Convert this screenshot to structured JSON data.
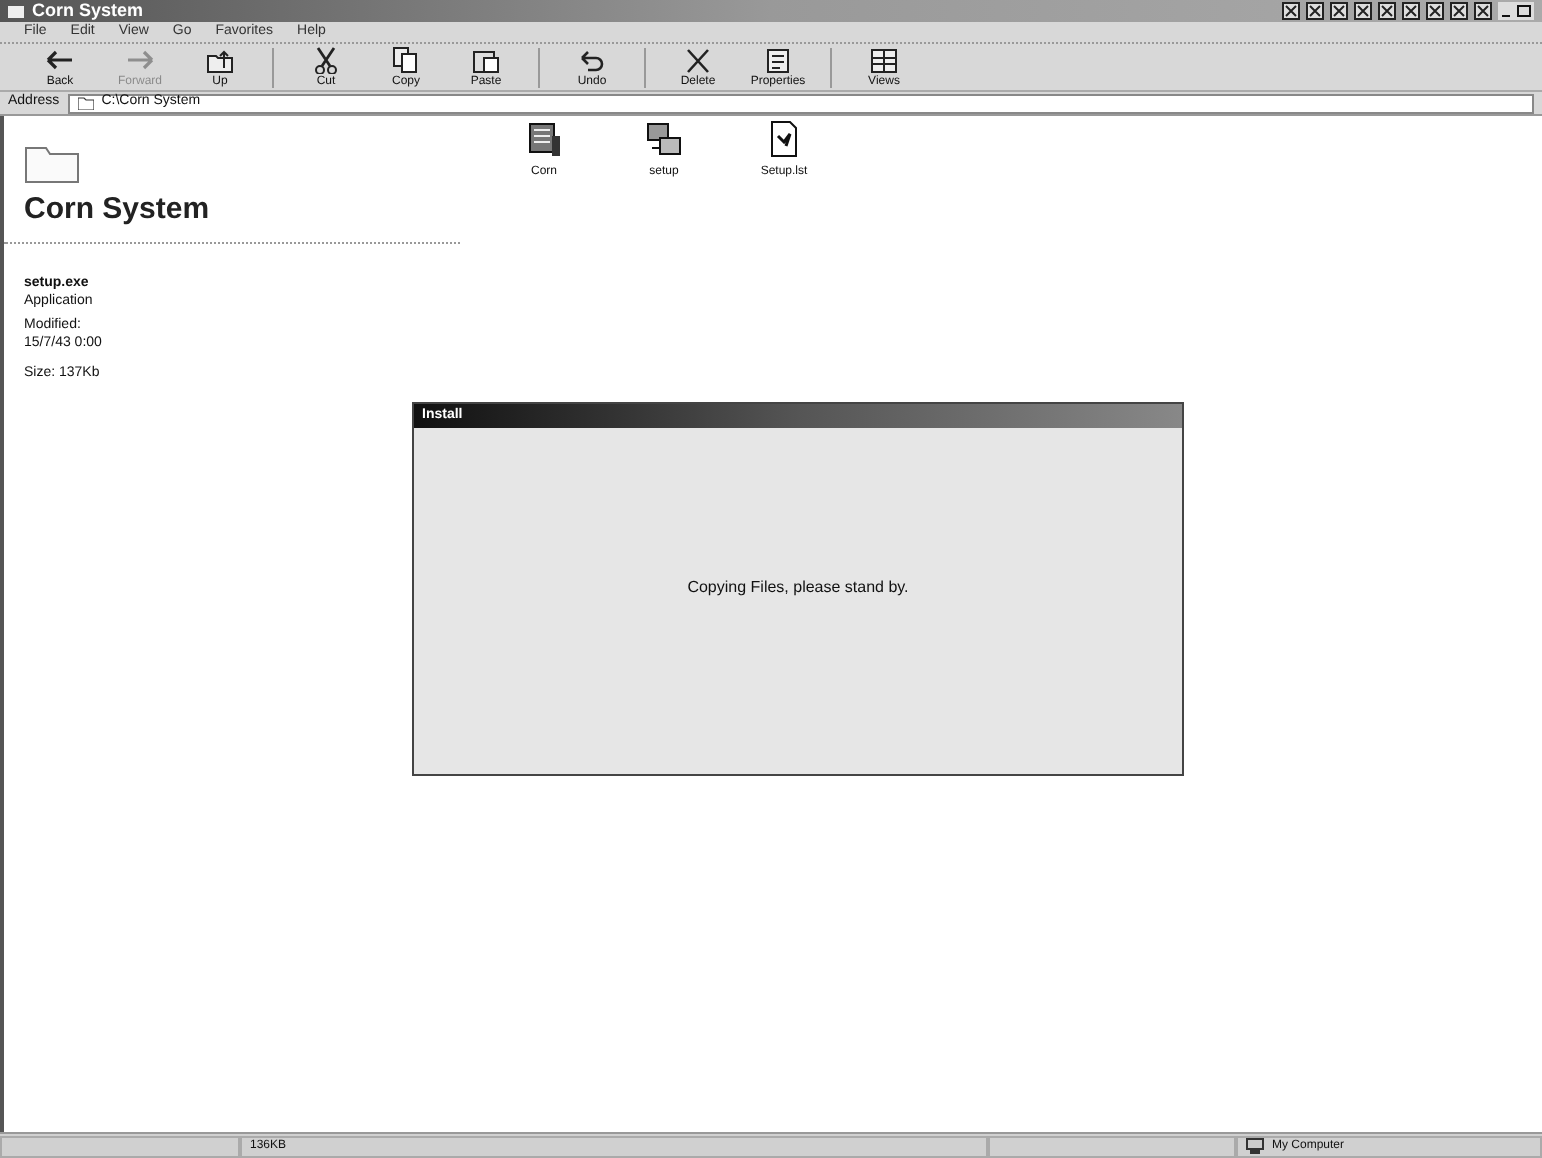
{
  "window": {
    "title": "Corn System"
  },
  "menu": [
    "File",
    "Edit",
    "View",
    "Go",
    "Favorites",
    "Help"
  ],
  "toolbar": [
    {
      "label": "Back",
      "kind": "back",
      "disabled": false
    },
    {
      "label": "Forward",
      "kind": "forward",
      "disabled": true
    },
    {
      "label": "Up",
      "kind": "up",
      "disabled": false
    },
    {
      "label": "Cut",
      "kind": "cut",
      "disabled": false
    },
    {
      "label": "Copy",
      "kind": "copy",
      "disabled": false
    },
    {
      "label": "Paste",
      "kind": "paste",
      "disabled": false
    },
    {
      "label": "Undo",
      "kind": "undo",
      "disabled": false
    },
    {
      "label": "Delete",
      "kind": "delete",
      "disabled": false
    },
    {
      "label": "Properties",
      "kind": "properties",
      "disabled": false
    },
    {
      "label": "Views",
      "kind": "views",
      "disabled": false
    }
  ],
  "address": {
    "label": "Address",
    "value": "C:\\Corn System"
  },
  "folder": {
    "title": "Corn System",
    "file_name": "setup.exe",
    "file_type": "Application",
    "modified_label": "Modified:",
    "modified": "15/7/43 0:00",
    "size": "Size: 137Kb"
  },
  "files": [
    {
      "name": "Corn",
      "kind": "drive"
    },
    {
      "name": "setup",
      "kind": "setup"
    },
    {
      "name": "Setup.lst",
      "kind": "doc"
    }
  ],
  "dialog": {
    "title": "Install",
    "message": "Copying Files, please stand by."
  },
  "status_bar": {
    "size": "136KB",
    "zone": "My Computer"
  }
}
